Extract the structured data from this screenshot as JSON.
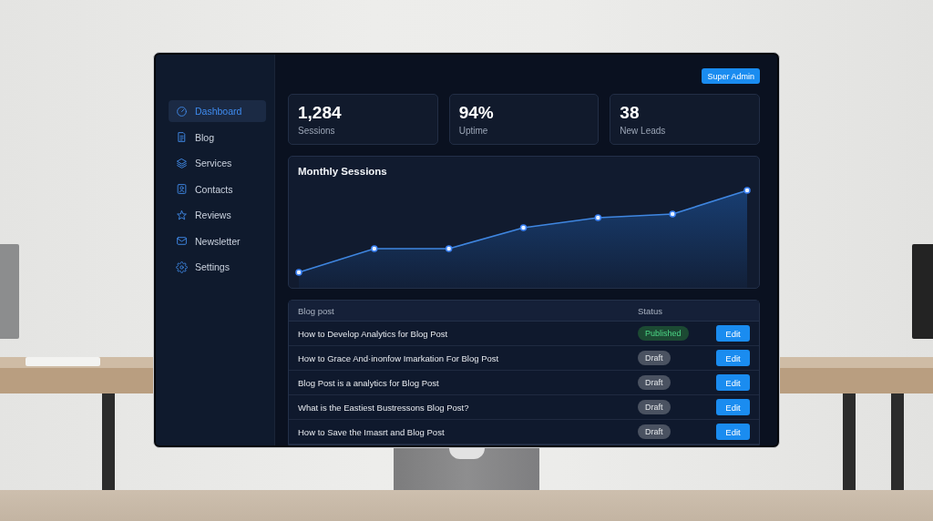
{
  "header": {
    "role_button": "Super Admin"
  },
  "sidebar": {
    "items": [
      {
        "label": "Dashboard",
        "selected": true
      },
      {
        "label": "Blog",
        "selected": false
      },
      {
        "label": "Services",
        "selected": false
      },
      {
        "label": "Contacts",
        "selected": false
      },
      {
        "label": "Reviews",
        "selected": false
      },
      {
        "label": "Newsletter",
        "selected": false
      },
      {
        "label": "Settings",
        "selected": false
      }
    ]
  },
  "stats": [
    {
      "value": "1,284",
      "label": "Sessions"
    },
    {
      "value": "94%",
      "label": "Uptime"
    },
    {
      "value": "38",
      "label": "New Leads"
    }
  ],
  "chart": {
    "title": "Monthly Sessions"
  },
  "table": {
    "columns": [
      "Blog post",
      "Status"
    ],
    "rows": [
      {
        "title": "How to Develop Analytics for Blog Post",
        "status": {
          "label": "Published",
          "kind": "published"
        },
        "action": "Edit"
      },
      {
        "title": "How to Grace And·inonfow Imarkation For Blog Post",
        "status": {
          "label": "Draft",
          "kind": "draft"
        },
        "action": "Edit"
      },
      {
        "title": "Blog Post is a analytics for Blog Post",
        "status": {
          "label": "Draft",
          "kind": "draft"
        },
        "action": "Edit"
      },
      {
        "title": "What is the Eastiest Bustressons Blog Post?",
        "status": {
          "label": "Draft",
          "kind": "draft"
        },
        "action": "Edit"
      },
      {
        "title": "How to Save the Imasrt and Blog Post",
        "status": {
          "label": "Draft",
          "kind": "draft"
        },
        "action": "Edit"
      }
    ]
  }
}
